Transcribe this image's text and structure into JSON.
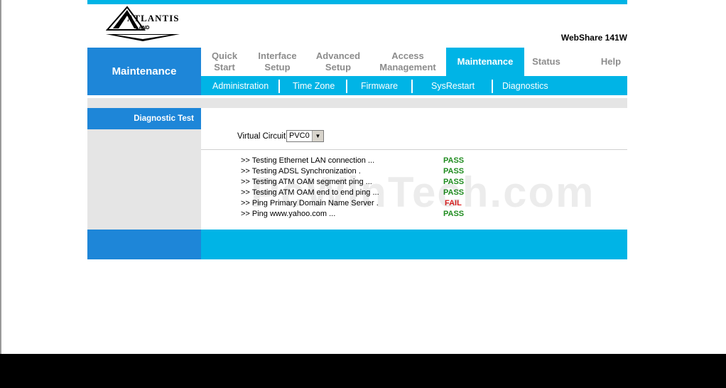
{
  "header": {
    "logo_text": "ATLANTIS LAND",
    "model": "WebShare 141W"
  },
  "section_title": "Maintenance",
  "main_tabs": [
    {
      "label": "Quick Start",
      "line1": "Quick",
      "line2": "Start",
      "active": false
    },
    {
      "label": "Interface Setup",
      "line1": "Interface",
      "line2": "Setup",
      "active": false
    },
    {
      "label": "Advanced Setup",
      "line1": "Advanced",
      "line2": "Setup",
      "active": false
    },
    {
      "label": "Access Management",
      "line1": "Access",
      "line2": "Management",
      "active": false
    },
    {
      "label": "Maintenance",
      "line1": "Maintenance",
      "line2": "",
      "active": true
    },
    {
      "label": "Status",
      "line1": "Status",
      "line2": "",
      "active": false
    },
    {
      "label": "Help",
      "line1": "Help",
      "line2": "",
      "active": false
    }
  ],
  "sub_tabs": [
    "Administration",
    "Time Zone",
    "Firmware",
    "SysRestart",
    "Diagnostics"
  ],
  "left_panel": {
    "heading": "Diagnostic Test"
  },
  "virtual_circuit": {
    "label": "Virtual Circuit:",
    "selected": "PVC0"
  },
  "results": [
    {
      "label": ">> Testing Ethernet LAN connection ...",
      "status": "PASS"
    },
    {
      "label": ">> Testing ADSL Synchronization .",
      "status": "PASS"
    },
    {
      "label": ">> Testing ATM OAM segment ping ...",
      "status": "PASS"
    },
    {
      "label": ">> Testing ATM OAM end to end ping ...",
      "status": "PASS"
    },
    {
      "label": ">> Ping Primary Domain Name Server .",
      "status": "FAIL"
    },
    {
      "label": ">> Ping www.yahoo.com ...",
      "status": "PASS"
    }
  ],
  "watermark": "PcWinTech.com",
  "colors": {
    "cyan": "#00b4e6",
    "blue": "#1e86d8",
    "pass": "#1f8c1f",
    "fail": "#e02020"
  }
}
